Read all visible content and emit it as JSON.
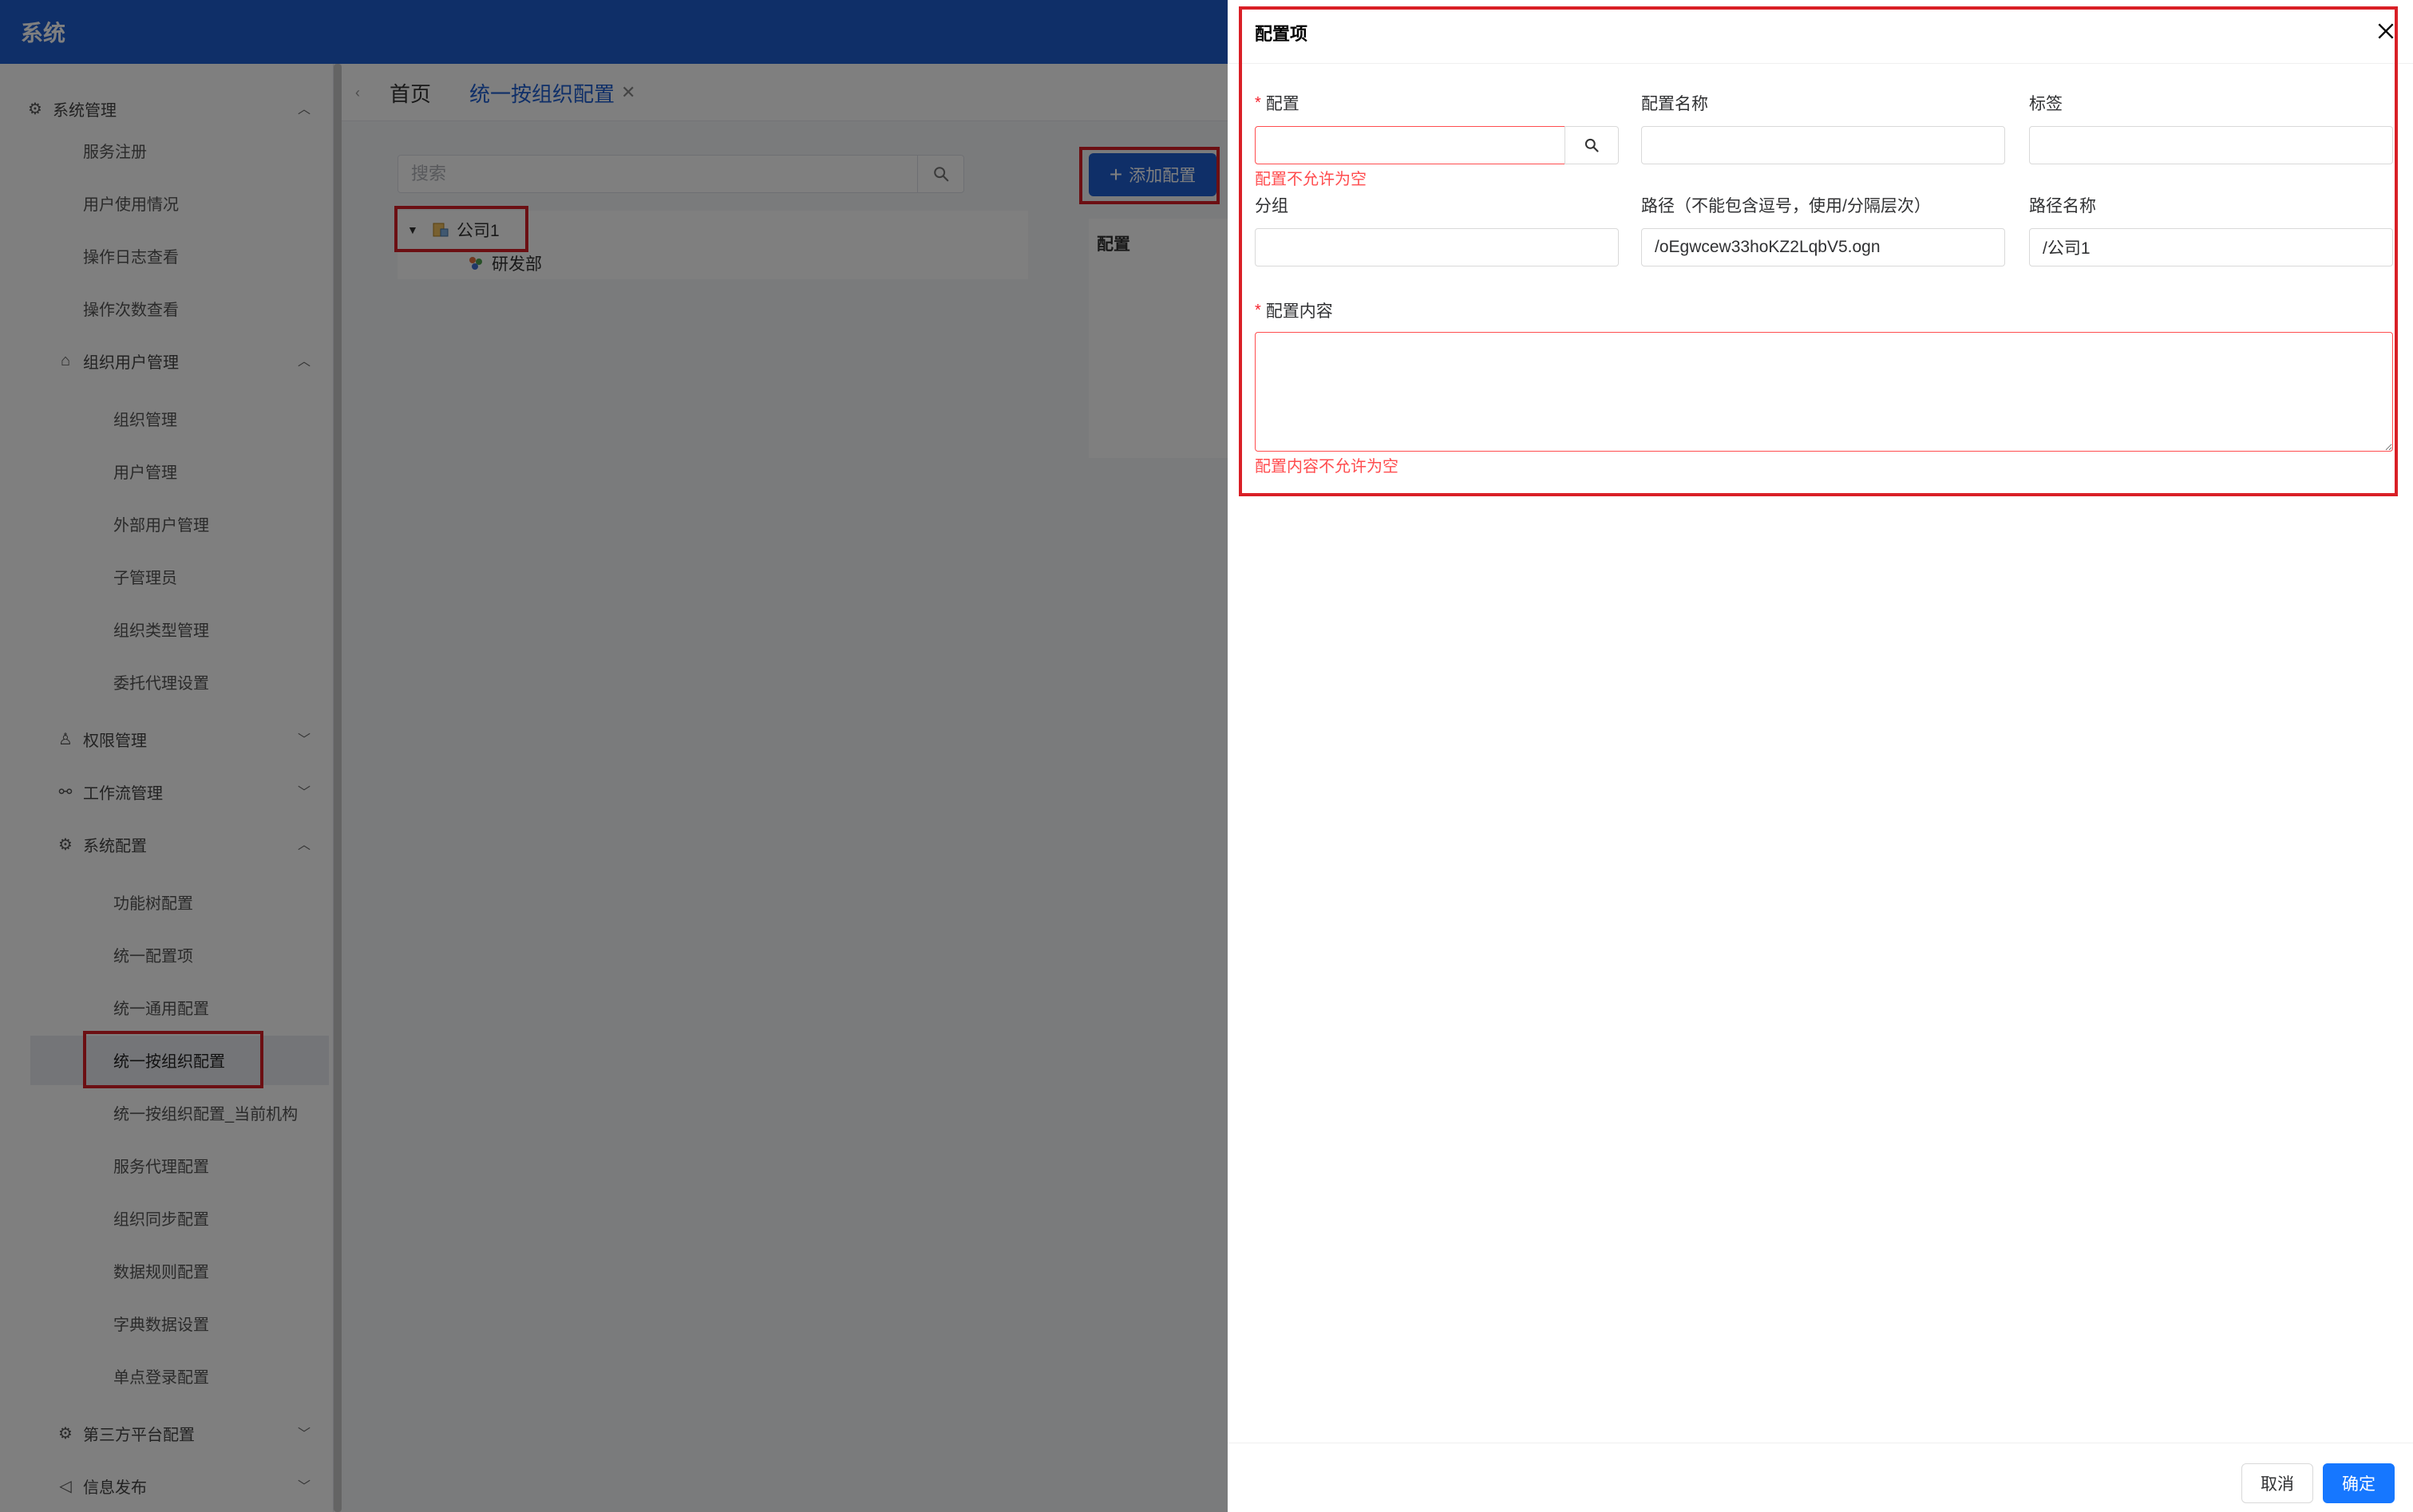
{
  "app": {
    "title": "系统"
  },
  "sidebar": {
    "system_mgmt": "系统管理",
    "system_mgmt_items": [
      "服务注册",
      "用户使用情况",
      "操作日志查看",
      "操作次数查看"
    ],
    "org_user_mgmt": "组织用户管理",
    "org_user_items": [
      "组织管理",
      "用户管理",
      "外部用户管理",
      "子管理员",
      "组织类型管理",
      "委托代理设置"
    ],
    "permission_mgmt": "权限管理",
    "workflow_mgmt": "工作流管理",
    "system_config": "系统配置",
    "system_config_items": [
      "功能树配置",
      "统一配置项",
      "统一通用配置",
      "统一按组织配置",
      "统一按组织配置_当前机构",
      "服务代理配置",
      "组织同步配置",
      "数据规则配置",
      "字典数据设置",
      "单点登录配置"
    ],
    "third_party": "第三方平台配置",
    "info_publish": "信息发布"
  },
  "tabs": {
    "home": "首页",
    "active": "统一按组织配置",
    "close": "✕"
  },
  "content": {
    "search_placeholder": "搜索",
    "tree": {
      "root": "公司1",
      "child": "研发部"
    },
    "add_button": "添加配置",
    "config_header": "配置"
  },
  "drawer": {
    "title": "配置项",
    "fields": {
      "config": {
        "label": "配置",
        "value": "",
        "error": "配置不允许为空"
      },
      "config_name": {
        "label": "配置名称",
        "value": ""
      },
      "tag": {
        "label": "标签",
        "value": ""
      },
      "group": {
        "label": "分组",
        "value": ""
      },
      "path": {
        "label": "路径（不能包含逗号，使用/分隔层次）",
        "value": "/oEgwcew33hoKZ2LqbV5.ogn"
      },
      "path_name": {
        "label": "路径名称",
        "value": "/公司1"
      },
      "content": {
        "label": "配置内容",
        "value": "",
        "error": "配置内容不允许为空"
      }
    },
    "required_mark": "*",
    "cancel": "取消",
    "ok": "确定"
  },
  "colors": {
    "primary": "#1f5fd1",
    "drawer_primary": "#1677ff",
    "error": "#ff4d4f",
    "highlight": "#d91f26"
  }
}
